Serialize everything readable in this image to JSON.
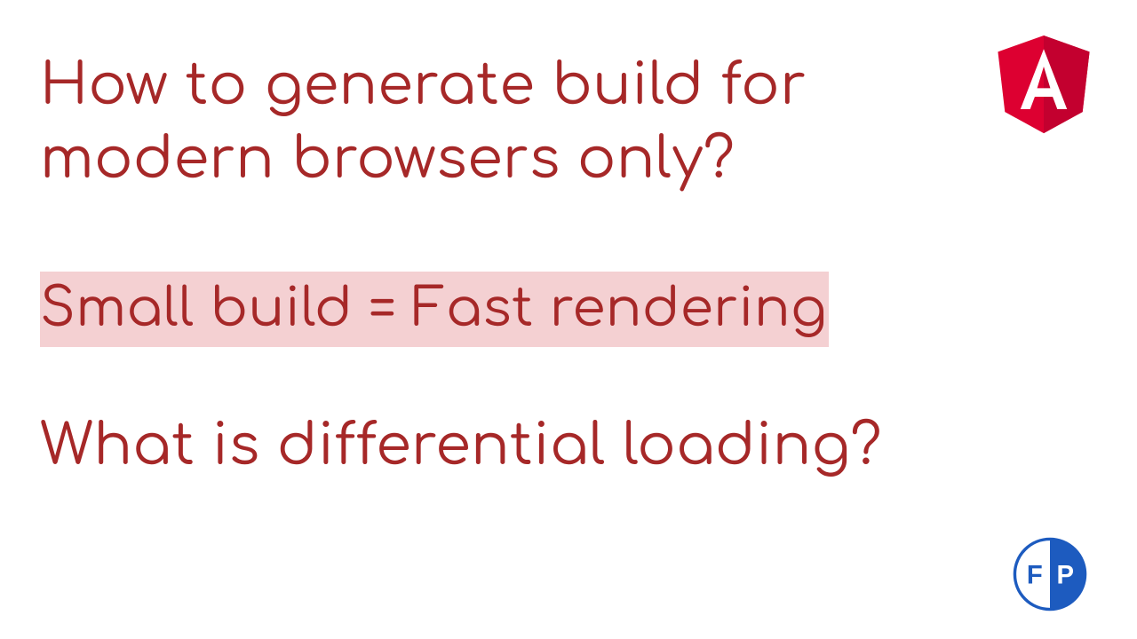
{
  "heading": {
    "line1": "How to generate build for",
    "line2": "modern browsers only?"
  },
  "highlight": "Small build = Fast rendering",
  "subheading": "What is differential loading?",
  "logos": {
    "angular": "angular-logo",
    "fp_letter_f": "F",
    "fp_letter_p": "P"
  },
  "colors": {
    "text": "#a62828",
    "highlight_bg": "#f4d0d2",
    "angular_red": "#dd0031",
    "angular_red_dark": "#c3002f",
    "fp_blue": "#1d5bbf"
  }
}
